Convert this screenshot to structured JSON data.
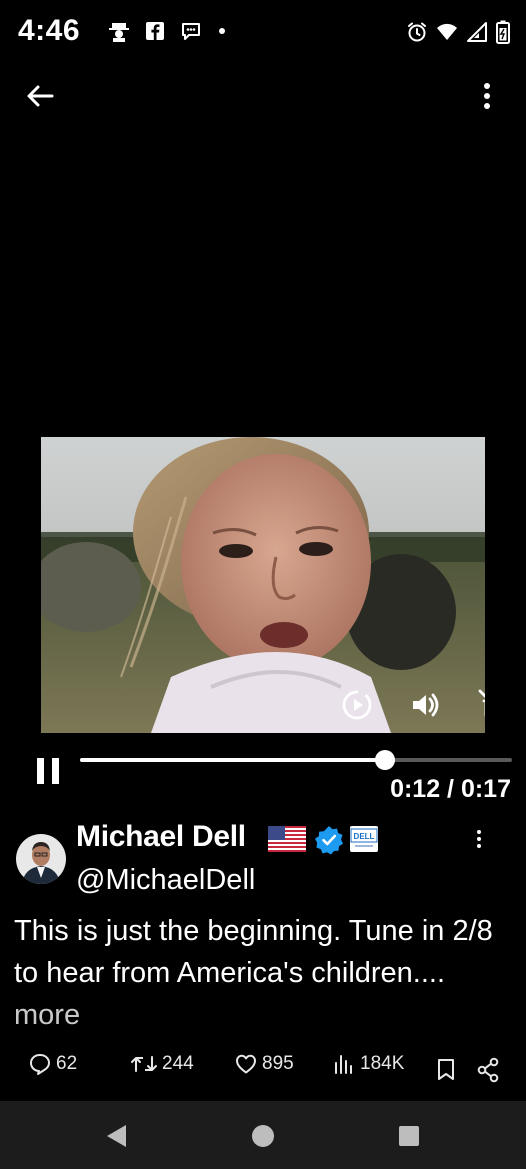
{
  "status_bar": {
    "time": "4:46",
    "left_icons": [
      "hat-person-icon",
      "facebook-icon",
      "messenger-icon",
      "dot-icon"
    ],
    "right_icons": [
      "alarm-icon",
      "wifi-icon",
      "signal-icon",
      "battery-icon"
    ]
  },
  "top_bar": {
    "back_icon": "back-arrow-icon",
    "more_icon": "more-vertical-icon"
  },
  "video": {
    "controls": [
      "replay-icon",
      "volume-icon",
      "pip-icon"
    ]
  },
  "player": {
    "progress": 0.706,
    "time_text": "0:12 / 0:17"
  },
  "tweet": {
    "author_name": "Michael Dell",
    "handle": "@MichaelDell",
    "text": "This is just the beginning. Tune in 2/8 to hear from America's children.... ",
    "more_label": "more",
    "brand_badge_text": "DELL",
    "accent_color": "#1d9bf0"
  },
  "actions": {
    "replies": "62",
    "retweets": "244",
    "likes": "895",
    "views": "184K"
  },
  "nav_bar": {
    "buttons": [
      "nav-back-icon",
      "nav-home-icon",
      "nav-recents-icon"
    ]
  }
}
